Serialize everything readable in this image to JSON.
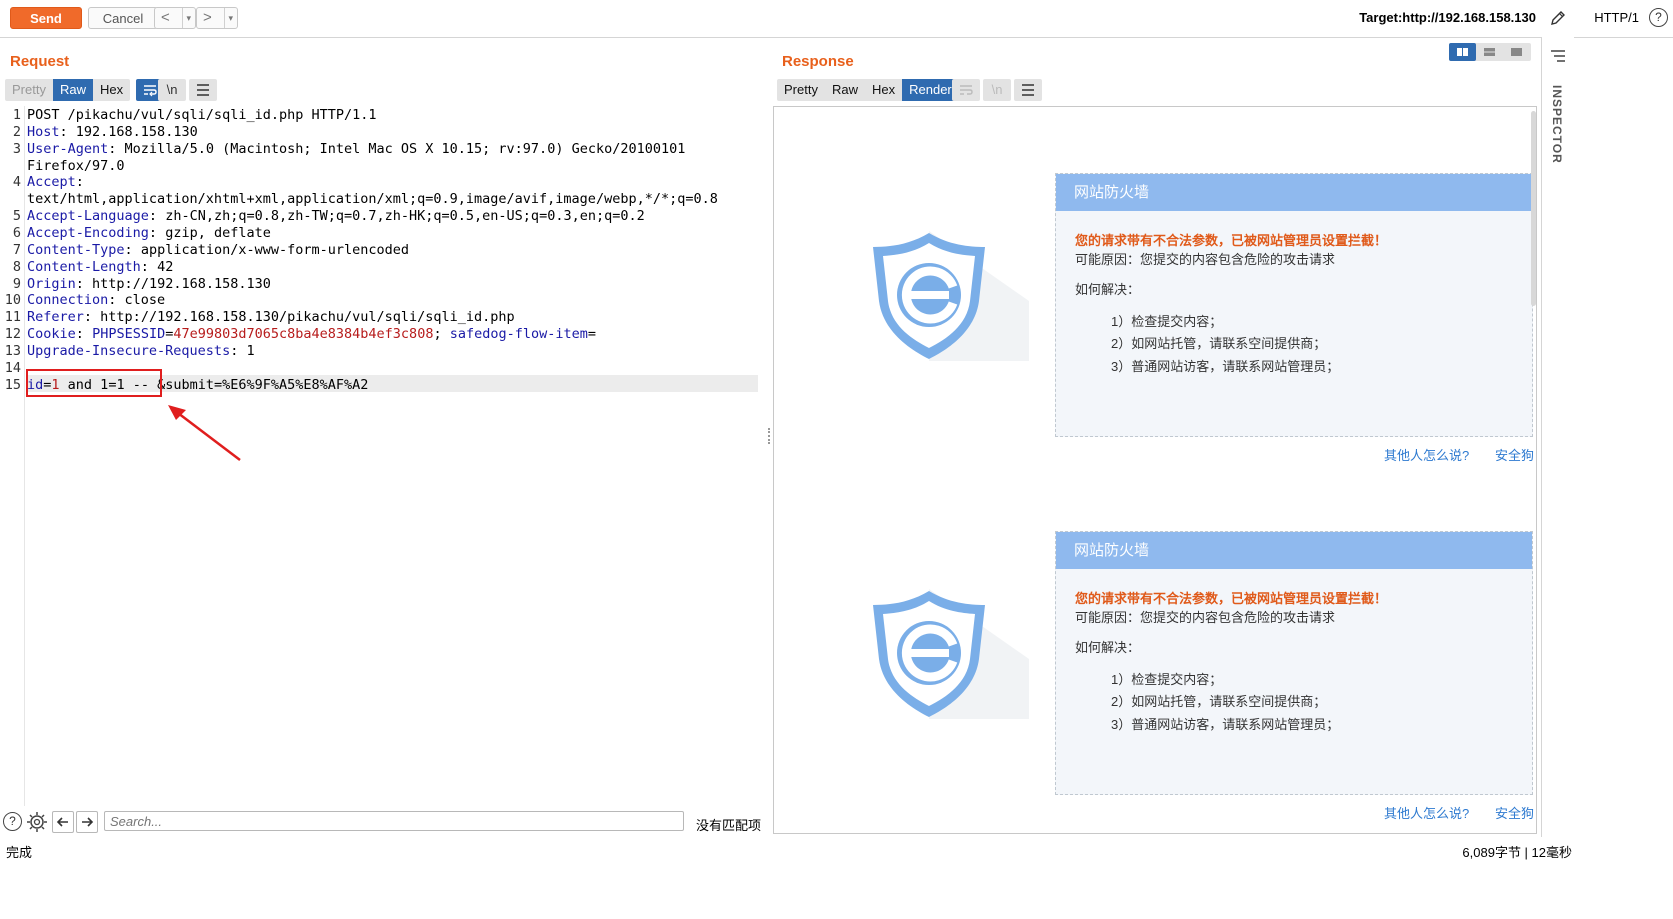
{
  "toolbar": {
    "send_label": "Send",
    "cancel_label": "Cancel",
    "back_label": "<",
    "forward_label": ">",
    "caret": "▾",
    "target": "Target:http://192.168.158.130",
    "http_version": "HTTP/1",
    "help": "?"
  },
  "request": {
    "title": "Request",
    "tabs": [
      "Pretty",
      "Raw",
      "Hex"
    ],
    "active_tab": "Raw",
    "newline_btn": "\\n",
    "lines": [
      {
        "num": "1",
        "text": "POST /pikachu/vul/sqli/sqli_id.php HTTP/1.1"
      },
      {
        "num": "2",
        "key": "Host",
        "value": " 192.168.158.130"
      },
      {
        "num": "3",
        "key": "User-Agent",
        "value": " Mozilla/5.0 (Macintosh; Intel Mac OS X 10.15; rv:97.0) Gecko/20100101"
      },
      {
        "num": "",
        "text": "Firefox/97.0"
      },
      {
        "num": "4",
        "key": "Accept",
        "value": ""
      },
      {
        "num": "",
        "text": "text/html,application/xhtml+xml,application/xml;q=0.9,image/avif,image/webp,*/*;q=0.8"
      },
      {
        "num": "5",
        "key": "Accept-Language",
        "value": " zh-CN,zh;q=0.8,zh-TW;q=0.7,zh-HK;q=0.5,en-US;q=0.3,en;q=0.2"
      },
      {
        "num": "6",
        "key": "Accept-Encoding",
        "value": " gzip, deflate"
      },
      {
        "num": "7",
        "key": "Content-Type",
        "value": " application/x-www-form-urlencoded"
      },
      {
        "num": "8",
        "key": "Content-Length",
        "value": " 42"
      },
      {
        "num": "9",
        "key": "Origin",
        "value": " http://192.168.158.130"
      },
      {
        "num": "10",
        "key": "Connection",
        "value": " close"
      },
      {
        "num": "11",
        "key": "Referer",
        "value": " http://192.168.158.130/pikachu/vul/sqli/sqli_id.php"
      },
      {
        "num": "12",
        "key": "Cookie",
        "value": ""
      },
      {
        "num": "13",
        "key": "Upgrade-Insecure-Requests",
        "value": " 1"
      },
      {
        "num": "14",
        "text": ""
      },
      {
        "num": "15",
        "text": ""
      }
    ],
    "cookie": {
      "name1": "PHPSESSID",
      "eq": "=",
      "val1": "47e99803d7065c8ba4e8384b4ef3c808",
      "sep": "; ",
      "name2": "safedog-flow-item",
      "eq2": "="
    },
    "body": {
      "param1": "id",
      "eq": "=",
      "val1": "1",
      "rest": " and 1=1 -- ",
      "rest2": "&submit=%E6%9F%A5%E8%AF%A2"
    }
  },
  "response": {
    "title": "Response",
    "tabs": [
      "Pretty",
      "Raw",
      "Hex",
      "Render"
    ],
    "active_tab": "Render",
    "newline_btn": "\\n",
    "cards": [
      {
        "header": "网站防火墙",
        "warning": "您的请求带有不合法参数，已被网站管理员设置拦截！",
        "reason": "可能原因：您提交的内容包含危险的攻击请求",
        "howto": "如何解决：",
        "steps": [
          "1）检查提交内容；",
          "2）如网站托管，请联系空间提供商；",
          "3）普通网站访客，请联系网站管理员；"
        ],
        "link1": "其他人怎么说?",
        "link2": "安全狗"
      },
      {
        "header": "网站防火墙",
        "warning": "您的请求带有不合法参数，已被网站管理员设置拦截！",
        "reason": "可能原因：您提交的内容包含危险的攻击请求",
        "howto": "如何解决：",
        "steps": [
          "1）检查提交内容；",
          "2）如网站托管，请联系空间提供商；",
          "3）普通网站访客，请联系网站管理员；"
        ],
        "link1": "其他人怎么说?",
        "link2": "安全狗"
      }
    ]
  },
  "search": {
    "placeholder": "Search...",
    "no_match": "没有匹配项"
  },
  "status": {
    "left": "完成",
    "right": "6,089字节 | 12毫秒"
  },
  "inspector": {
    "label": "INSPECTOR"
  },
  "colors": {
    "accent": "#f06a2a",
    "active_tab": "#2f6bb0",
    "highlight_box": "#e01e1e",
    "firewall_header": "#8fb9ee"
  }
}
